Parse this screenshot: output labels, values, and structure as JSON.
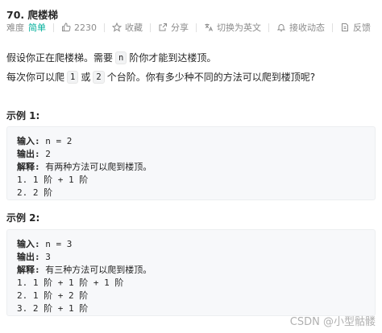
{
  "problem": {
    "title": "70. 爬楼梯"
  },
  "meta": {
    "difficulty_label": "难度",
    "difficulty_value": "简单",
    "likes_count": "2230",
    "favorite_label": "收藏",
    "share_label": "分享",
    "translate_label": "切换为英文",
    "notify_label": "接收动态",
    "feedback_label": "反馈"
  },
  "description": {
    "line1_part1": "假设你正在爬楼梯。需要",
    "line1_code": "n",
    "line1_part2": "阶你才能到达楼顶。",
    "line2_part1": "每次你可以爬",
    "line2_code1": "1",
    "line2_mid": "或",
    "line2_code2": "2",
    "line2_part2": "个台阶。你有多少种不同的方法可以爬到楼顶呢?"
  },
  "examples": [
    {
      "heading": "示例 1:",
      "input_label": "输入:",
      "input_value": "n = 2",
      "output_label": "输出:",
      "output_value": "2",
      "explain_label": "解释:",
      "explain_value": "有两种方法可以爬到楼顶。",
      "steps": [
        "1. 1 阶 + 1 阶",
        "2. 2 阶"
      ]
    },
    {
      "heading": "示例 2:",
      "input_label": "输入:",
      "input_value": "n = 3",
      "output_label": "输出:",
      "output_value": "3",
      "explain_label": "解释:",
      "explain_value": "有三种方法可以爬到楼顶。",
      "steps": [
        "1. 1 阶 + 1 阶 + 1 阶",
        "2. 1 阶 + 2 阶",
        "3. 2 阶 + 1 阶"
      ]
    }
  ],
  "watermark": "CSDN @小型骷髅",
  "colors": {
    "difficulty_easy": "#00af9b",
    "meta_text": "#8c8c8c",
    "example_bg": "#f7f8fa"
  }
}
